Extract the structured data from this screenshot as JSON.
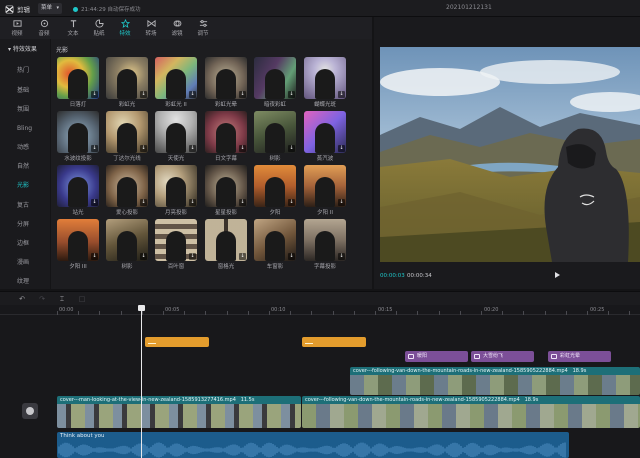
{
  "app": {
    "name": "剪辑",
    "menu_label": "菜单",
    "save_status": "21:44:29 自动保存成功",
    "project_title": "20210121213​1"
  },
  "toolbar": {
    "tabs": [
      {
        "label": "视频",
        "icon": "video-icon"
      },
      {
        "label": "音频",
        "icon": "audio-icon"
      },
      {
        "label": "文本",
        "icon": "text-icon"
      },
      {
        "label": "贴纸",
        "icon": "sticker-icon"
      },
      {
        "label": "特效",
        "icon": "effects-icon",
        "active": true
      },
      {
        "label": "转场",
        "icon": "transition-icon"
      },
      {
        "label": "滤镜",
        "icon": "filter-icon"
      },
      {
        "label": "调节",
        "icon": "adjust-icon"
      }
    ]
  },
  "categories": {
    "header": "▾ 特效效果",
    "items": [
      "热门",
      "基础",
      "氛围",
      "Bling",
      "动感",
      "自然",
      "光影",
      "复古",
      "分屏",
      "边框",
      "漫画",
      "纹理"
    ],
    "active": "光影"
  },
  "effects": {
    "section": "光影",
    "items": [
      "日落灯",
      "彩虹光",
      "彩虹光 II",
      "彩虹光晕",
      "暗夜彩虹",
      "蝴蝶光斑",
      "水波纹投影",
      "丁达尔光线",
      "天使光",
      "日文字幕",
      "树影",
      "蒸汽波",
      "站光",
      "爱心投影",
      "月亮投影",
      "星星投影",
      "夕阳",
      "夕阳 II",
      "夕阳 III",
      "树影",
      "百叶窗",
      "窗格光",
      "车窗影",
      "字幕投影"
    ]
  },
  "preview": {
    "current_time": "00:00:03",
    "total_time": "00:00:34"
  },
  "timeline": {
    "ruler": [
      "00:00",
      "00:05",
      "00:10",
      "00:15",
      "00:20",
      "00:25"
    ],
    "effect_clips": [
      "暖阳",
      "大雪纷飞",
      "彩虹光晕"
    ],
    "video_clips": [
      {
        "name": "cover---man-looking-at-the-view-in-new-zealand-1585913277416.mp4",
        "duration": "11.5s"
      },
      {
        "name": "cover---following-van-down-the-mountain-roads-in-new-zealand-1585905222884.mp4",
        "duration": "18.9s"
      },
      {
        "name": "cover---following-van-down-the-mountain-roads-in-new-zealand-1585905222884.mp4",
        "duration": "18.9s"
      }
    ],
    "audio_clip": "Think about you"
  },
  "colors": {
    "accent": "#1fc7c9",
    "effect_clip": "#7c4f98",
    "sticker_clip": "#e39c2d",
    "video_header": "#1d6f78",
    "audio_clip": "#1c5c8c"
  }
}
